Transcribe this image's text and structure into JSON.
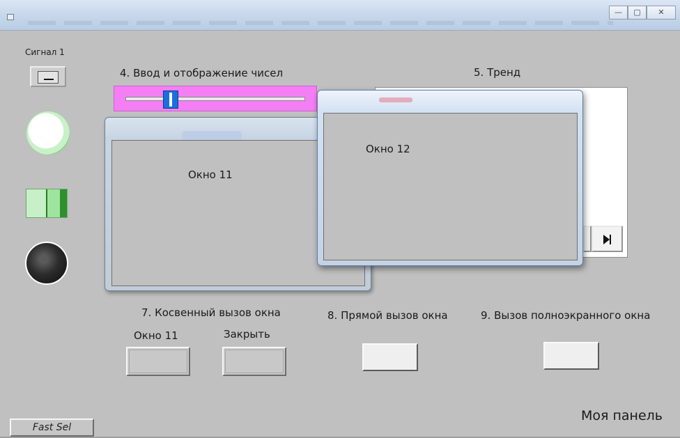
{
  "window": {
    "controls": {
      "minimize": "—",
      "maximize": "▢",
      "close": "✕"
    }
  },
  "left_panel": {
    "signal_label": "Сигнал 1"
  },
  "section4": {
    "title": "4. Ввод и отображение чисел",
    "slider_value_fraction": 0.23
  },
  "section5": {
    "title": "5. Тренд"
  },
  "window11": {
    "label": "Окно 11"
  },
  "window12": {
    "label": "Окно 12"
  },
  "section7": {
    "title": "7. Косвенный вызов окна",
    "open_label": "Окно 11",
    "close_label": "Закрыть"
  },
  "section8": {
    "title": "8. Прямой вызов окна"
  },
  "section9": {
    "title": "9. Вызов полноэкранного окна"
  },
  "footer": {
    "panel_name": "Моя панель",
    "fast_sel": "Fast Sel"
  },
  "colors": {
    "background": "#c0c0c0",
    "slider_bg": "#f47ff4",
    "slider_thumb": "#1a6fe0",
    "lamp_on": "#7fd67f",
    "toggle_green": "#9ee49e"
  }
}
